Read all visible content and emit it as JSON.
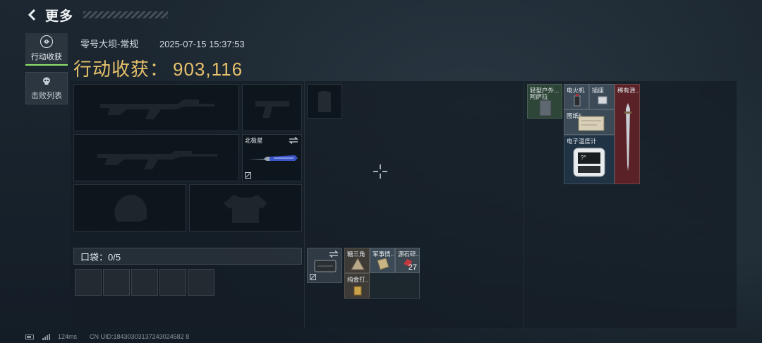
{
  "header": {
    "back_icon": "chevron-left-icon",
    "title": "更多"
  },
  "tabs": [
    {
      "label": "行动收获",
      "icon": "coin-icon",
      "active": true
    },
    {
      "label": "击败列表",
      "icon": "skull-icon",
      "active": false
    }
  ],
  "match": {
    "map": "零号大坝-常规",
    "datetime": "2025-07-15 15:37:53"
  },
  "gain": {
    "label": "行动收获：",
    "value": "903,116"
  },
  "equipment": {
    "knife_name": "北极星",
    "pocket_label": "口袋：0/5"
  },
  "backpack_items": [
    {
      "name": "糖三角"
    },
    {
      "name": "军事情..."
    },
    {
      "name": "源石碎...",
      "count": "27"
    },
    {
      "name": "纯金打..."
    }
  ],
  "safebox_items": [
    {
      "name": "轻型户外...",
      "sub": "阿萨拉"
    },
    {
      "name": "电火机"
    },
    {
      "name": "插座"
    },
    {
      "name": "稀有滑..."
    },
    {
      "name": "图纸5..."
    },
    {
      "name": "电子温度计",
      "screen": "?°"
    }
  ],
  "status": {
    "ping": "124ms",
    "uid": "CN UID:18430303137243024582 8"
  },
  "colors": {
    "accent_green": "#8fe36a",
    "gold": "#e7c16b",
    "rare_red": "#5a2227",
    "safe_green": "#2e4638",
    "blue_item": "#1f3344"
  }
}
